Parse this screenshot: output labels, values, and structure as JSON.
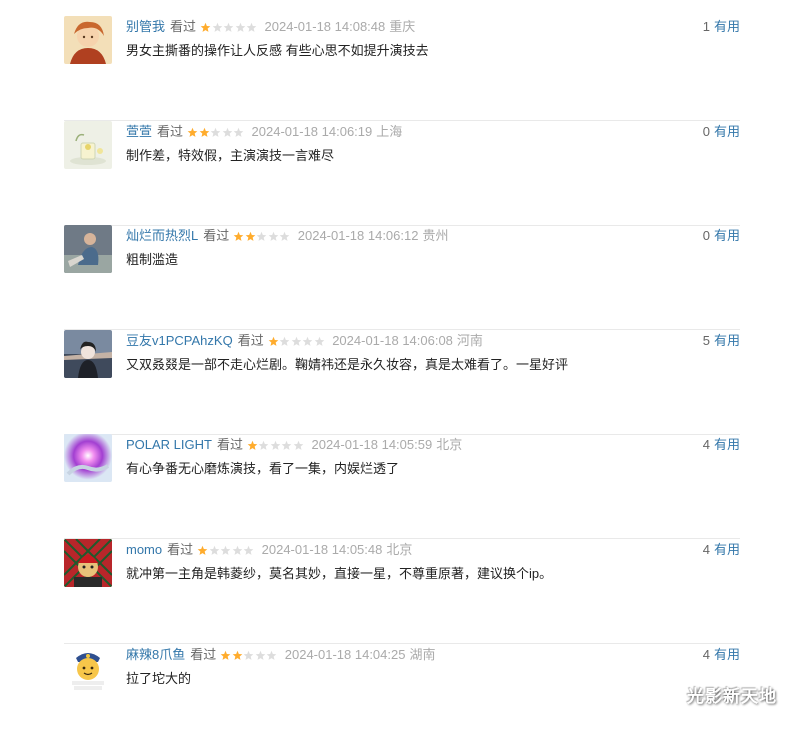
{
  "colors": {
    "user_link": "#3377aa",
    "star_filled": "#ffac2d",
    "star_empty": "#dddddd",
    "meta_gray": "#aaaaaa",
    "divider": "#e9e9e9"
  },
  "comments": [
    {
      "user": "别管我",
      "status": "看过",
      "rating": 1,
      "time": "2024-01-18 14:08:48",
      "location": "重庆",
      "votes": "1",
      "vote_label": "有用",
      "text": "男女主撕番的操作让人反感 有些心思不如提升演技去"
    },
    {
      "user": "萱萱",
      "status": "看过",
      "rating": 2,
      "time": "2024-01-18 14:06:19",
      "location": "上海",
      "votes": "0",
      "vote_label": "有用",
      "text": "制作差，特效假，主演演技一言难尽"
    },
    {
      "user": "灿烂而热烈L",
      "status": "看过",
      "rating": 2,
      "time": "2024-01-18 14:06:12",
      "location": "贵州",
      "votes": "0",
      "vote_label": "有用",
      "text": "粗制滥造"
    },
    {
      "user": "豆友v1PCPAhzKQ",
      "status": "看过",
      "rating": 1,
      "time": "2024-01-18 14:06:08",
      "location": "河南",
      "votes": "5",
      "vote_label": "有用",
      "text": "又双叒叕是一部不走心烂剧。鞠婧祎还是永久妆容，真是太难看了。一星好评"
    },
    {
      "user": "POLAR LIGHT",
      "status": "看过",
      "rating": 1,
      "time": "2024-01-18 14:05:59",
      "location": "北京",
      "votes": "4",
      "vote_label": "有用",
      "text": "有心争番无心磨炼演技，看了一集，内娱烂透了"
    },
    {
      "user": "momo",
      "status": "看过",
      "rating": 1,
      "time": "2024-01-18 14:05:48",
      "location": "北京",
      "votes": "4",
      "vote_label": "有用",
      "text": "就冲第一主角是韩菱纱，莫名其妙，直接一星，不尊重原著，建议换个ip。"
    },
    {
      "user": "麻辣8爪鱼",
      "status": "看过",
      "rating": 2,
      "time": "2024-01-18 14:04:25",
      "location": "湖南",
      "votes": "4",
      "vote_label": "有用",
      "text": "拉了坨大的"
    }
  ],
  "watermark": "光影新天地"
}
